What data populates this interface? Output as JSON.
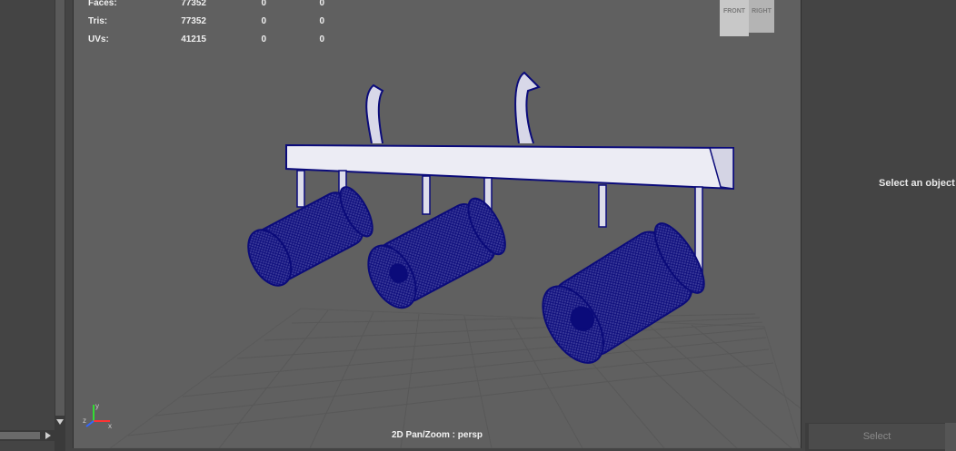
{
  "hud": {
    "rows": [
      {
        "label": "Faces:",
        "v1": "77352",
        "v2": "0",
        "v3": "0"
      },
      {
        "label": "Tris:",
        "v1": "77352",
        "v2": "0",
        "v3": "0"
      },
      {
        "label": "UVs:",
        "v1": "41215",
        "v2": "0",
        "v3": "0"
      }
    ]
  },
  "viewcube": {
    "front": "FRONT",
    "right": "RIGHT"
  },
  "viewport": {
    "camera_label": "2D Pan/Zoom : persp"
  },
  "attribute_panel": {
    "message": "Select an object t",
    "select_button": "Select"
  },
  "axis": {
    "x": "x",
    "y": "y",
    "z": "z"
  },
  "colors": {
    "wireframe": "#0b0b7a",
    "viewport_bg": "#606060",
    "panel_bg": "#444444"
  }
}
